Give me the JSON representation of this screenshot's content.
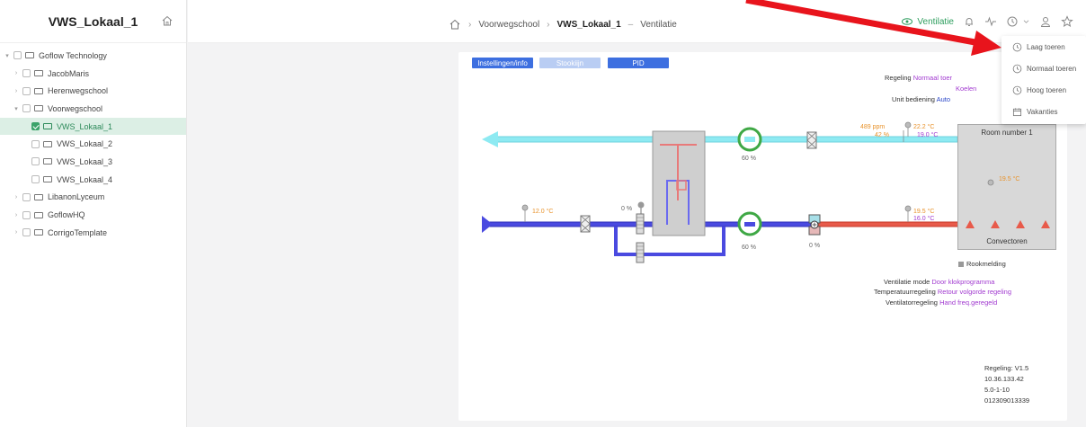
{
  "sidebar": {
    "title": "VWS_Lokaal_1",
    "items": [
      {
        "label": "Goflow Technology",
        "caret": "▾",
        "checked": false,
        "active": false,
        "indent": 0
      },
      {
        "label": "JacobMaris",
        "caret": "›",
        "checked": false,
        "active": false,
        "indent": 1
      },
      {
        "label": "Herenwegschool",
        "caret": "›",
        "checked": false,
        "active": false,
        "indent": 1
      },
      {
        "label": "Voorwegschool",
        "caret": "▾",
        "checked": false,
        "active": false,
        "indent": 1
      },
      {
        "label": "VWS_Lokaal_1",
        "caret": "",
        "checked": true,
        "active": true,
        "indent": 2
      },
      {
        "label": "VWS_Lokaal_2",
        "caret": "",
        "checked": false,
        "active": false,
        "indent": 2
      },
      {
        "label": "VWS_Lokaal_3",
        "caret": "",
        "checked": false,
        "active": false,
        "indent": 2
      },
      {
        "label": "VWS_Lokaal_4",
        "caret": "",
        "checked": false,
        "active": false,
        "indent": 2
      },
      {
        "label": "LibanonLyceum",
        "caret": "›",
        "checked": false,
        "active": false,
        "indent": 1
      },
      {
        "label": "GoflowHQ",
        "caret": "›",
        "checked": false,
        "active": false,
        "indent": 1
      },
      {
        "label": "CorrigoTemplate",
        "caret": "›",
        "checked": false,
        "active": false,
        "indent": 1
      }
    ]
  },
  "breadcrumb": {
    "sep": "›",
    "item1": "Voorwegschool",
    "item2": "VWS_Lokaal_1",
    "dash": "–",
    "item3": "Ventilatie"
  },
  "topbar": {
    "status_label": "Ventilatie"
  },
  "tabs": {
    "tab1": "Instellingen/info",
    "tab2": "Stookiijn",
    "tab3": "PID"
  },
  "info": {
    "regeling_label": "Regeling",
    "regeling_value": "Normaal toer",
    "regeling_value2": "Koelen",
    "unit_label": "Unit bediening",
    "unit_value": "Auto",
    "ventmode_label": "Ventilatie mode",
    "ventmode_value": "Door klokprogramma",
    "temp_label": "Temperatuurregeling",
    "temp_value": "Retour volgorde regeling",
    "ventreg_label": "Ventilatorregeling",
    "ventreg_value": "Hand freq.geregeld"
  },
  "diagram": {
    "ppm": "489 ppm",
    "humidity": "42 %",
    "temp_return": "22.2 °C",
    "temp_return2": "19.0 °C",
    "fan_top_pct": "60 %",
    "fan_bottom_pct": "60 %",
    "outside_temp": "12.0 °C",
    "valve_pct": "0 %",
    "heater_pct": "0 %",
    "supply_temp": "19.5 °C",
    "supply_temp2": "16.0 °C",
    "room_title": "Room number  1",
    "room_temp": "19.5 °C",
    "convector_label": "Convectoren",
    "smoke_label": "Rookmelding"
  },
  "footer": {
    "line1": "Regeling: V1.5",
    "line2": "10.36.133.42",
    "line3": "5.0-1-10",
    "line4": "012309013339"
  },
  "dropdown": {
    "items": [
      "Laag toeren",
      "Normaal toeren",
      "Hoog toeren",
      "Vakanties"
    ]
  },
  "colors": {
    "accent": "#2e9e5e",
    "tab_blue": "#3d6fe0",
    "tab_light": "#b9cdf3",
    "supply_duct": "#4a4ae0",
    "return_duct": "#8eeaf2",
    "hot_duct": "#e85a4a",
    "arrow_red": "#e8141c",
    "value_purple": "#a23bd0",
    "value_orange": "#e8922a"
  }
}
